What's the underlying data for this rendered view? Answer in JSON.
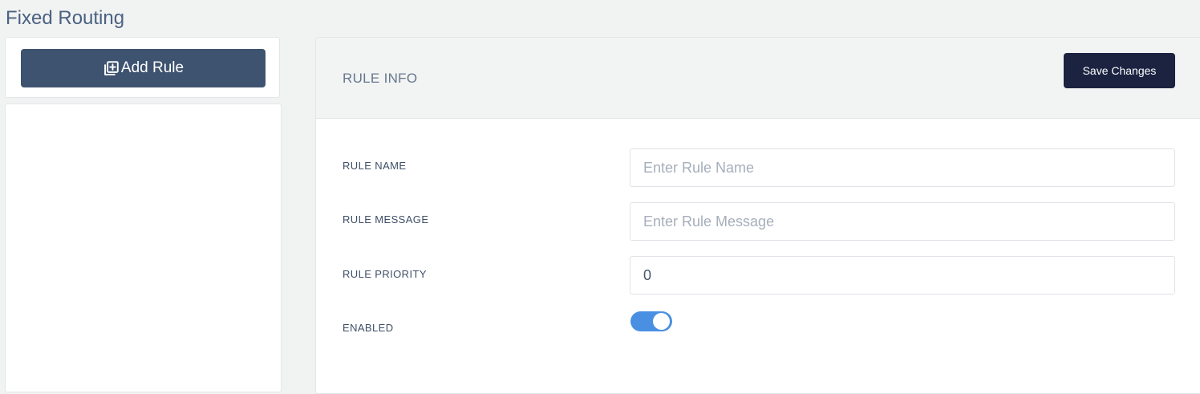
{
  "page": {
    "title": "Fixed Routing"
  },
  "sidebar": {
    "add_rule_label": "Add Rule",
    "add_rule_icon": "add-to-queue-icon"
  },
  "panel": {
    "title": "RULE INFO",
    "save_label": "Save Changes",
    "fields": {
      "rule_name": {
        "label": "RULE NAME",
        "placeholder": "Enter Rule Name",
        "value": ""
      },
      "rule_message": {
        "label": "RULE MESSAGE",
        "placeholder": "Enter Rule Message",
        "value": ""
      },
      "rule_priority": {
        "label": "RULE PRIORITY",
        "placeholder": "",
        "value": "0"
      },
      "enabled": {
        "label": "ENABLED",
        "checked": true
      }
    }
  },
  "colors": {
    "primary_button": "#3e536f",
    "save_button": "#1b2341",
    "toggle_on": "#4a90e2",
    "title_text": "#4a6282"
  }
}
